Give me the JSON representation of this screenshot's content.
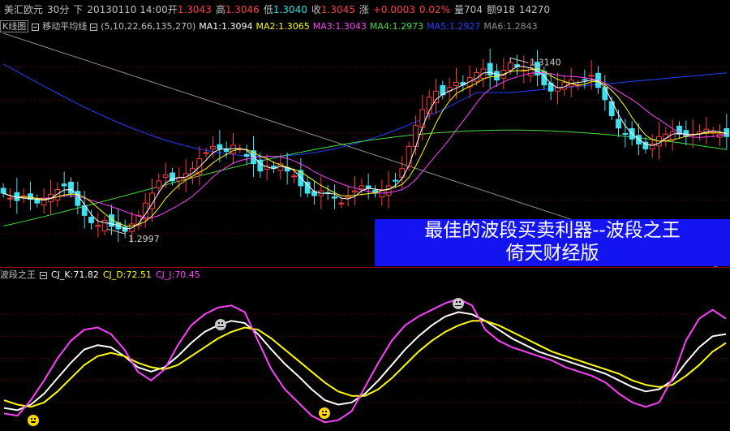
{
  "header": {
    "symbol": "美汇欧元",
    "period": "30分",
    "dir": "下",
    "datetime": "20130110 14:00",
    "open_label": "开",
    "open": "1.3043",
    "high_label": "高",
    "high": "1.3046",
    "low_label": "低",
    "low": "1.3040",
    "close_label": "收",
    "close": "1.3045",
    "change_label": "涨",
    "change": "+0.0003",
    "change_pct": "0.02%",
    "volume": "量704",
    "amount": "额918",
    "extra": "14270"
  },
  "ma_bar": {
    "chart_name": "K线图",
    "indicator": "移动平均线",
    "params": "(5,10,22,66,135,270)",
    "items": [
      {
        "label": "MA1:",
        "value": "1.3094",
        "color": "#ffffff"
      },
      {
        "label": "MA2:",
        "value": "1.3065",
        "color": "#ffff00"
      },
      {
        "label": "MA3:",
        "value": "1.3043",
        "color": "#ff40ff"
      },
      {
        "label": "MA4:",
        "value": "1.2973",
        "color": "#40e040"
      },
      {
        "label": "MA5:",
        "value": "1.2927",
        "color": "#2040ff"
      },
      {
        "label": "MA6:",
        "value": "1.2843",
        "color": "#909090"
      }
    ]
  },
  "sub_bar": {
    "name": "波段之王",
    "items": [
      {
        "label": "CJ_K:",
        "value": "71.82",
        "color": "#ffffff"
      },
      {
        "label": "CJ_D:",
        "value": "72.51",
        "color": "#ffff00"
      },
      {
        "label": "CJ_J:",
        "value": "70.45",
        "color": "#ff40ff"
      }
    ]
  },
  "banner": {
    "line1": "最佳的波段买卖利器--波段之王",
    "line2": "倚天财经版"
  },
  "annotations": {
    "high_mark": "1.3140",
    "low_mark": "1.2997"
  },
  "chart_data": [
    {
      "type": "candlestick",
      "ylim": [
        1.297,
        1.316
      ],
      "grid": true,
      "markers": [
        {
          "label": "1.3140",
          "value": 1.314
        },
        {
          "label": "1.2997",
          "value": 1.2997
        }
      ],
      "closes": [
        1.303,
        1.3026,
        1.3024,
        1.3028,
        1.3025,
        1.3022,
        1.3026,
        1.3029,
        1.3033,
        1.3036,
        1.303,
        1.302,
        1.3012,
        1.3006,
        1.3004,
        1.3008,
        1.3003,
        1.3001,
        1.2999,
        1.3005,
        1.3012,
        1.3022,
        1.303,
        1.304,
        1.3045,
        1.304,
        1.3043,
        1.3046,
        1.305,
        1.3058,
        1.3063,
        1.3068,
        1.3066,
        1.3064,
        1.3069,
        1.3066,
        1.306,
        1.3054,
        1.3048,
        1.3052,
        1.305,
        1.3054,
        1.3048,
        1.3044,
        1.3036,
        1.303,
        1.3028,
        1.3032,
        1.303,
        1.3026,
        1.3022,
        1.3028,
        1.3032,
        1.3036,
        1.3034,
        1.303,
        1.3033,
        1.3036,
        1.304,
        1.305,
        1.3068,
        1.3085,
        1.3098,
        1.3108,
        1.3113,
        1.311,
        1.3116,
        1.312,
        1.3118,
        1.3124,
        1.3128,
        1.3131,
        1.3126,
        1.3122,
        1.313,
        1.3136,
        1.3133,
        1.313,
        1.3132,
        1.3126,
        1.3118,
        1.3113,
        1.3116,
        1.312,
        1.3122,
        1.3118,
        1.3122,
        1.3126,
        1.3116,
        1.3106,
        1.3093,
        1.3083,
        1.3078,
        1.3074,
        1.307,
        1.3066,
        1.307,
        1.3076,
        1.3078,
        1.308,
        1.3078,
        1.3076,
        1.3078,
        1.308,
        1.3082,
        1.308,
        1.3078,
        1.3076
      ]
    },
    {
      "type": "line",
      "ylim": [
        -10,
        110
      ],
      "series": [
        {
          "name": "CJ_K",
          "color": "#ffffff",
          "values": [
            5,
            3,
            8,
            18,
            32,
            46,
            58,
            62,
            60,
            52,
            42,
            38,
            42,
            52,
            64,
            74,
            80,
            84,
            82,
            72,
            58,
            45,
            34,
            22,
            12,
            8,
            10,
            18,
            30,
            44,
            58,
            70,
            80,
            88,
            92,
            90,
            84,
            76,
            68,
            62,
            56,
            52,
            48,
            44,
            40,
            36,
            30,
            24,
            20,
            22,
            30,
            46,
            60,
            70,
            72
          ]
        },
        {
          "name": "CJ_D",
          "color": "#ffff00",
          "values": [
            12,
            8,
            6,
            10,
            20,
            32,
            44,
            52,
            55,
            52,
            46,
            42,
            40,
            44,
            52,
            60,
            68,
            74,
            78,
            76,
            68,
            58,
            48,
            38,
            28,
            20,
            16,
            16,
            22,
            32,
            44,
            56,
            66,
            74,
            80,
            84,
            84,
            80,
            74,
            68,
            62,
            56,
            52,
            48,
            44,
            40,
            36,
            30,
            26,
            24,
            26,
            34,
            44,
            56,
            64
          ]
        },
        {
          "name": "CJ_J",
          "color": "#ff40ff",
          "values": [
            0,
            -2,
            12,
            30,
            50,
            66,
            76,
            78,
            72,
            58,
            38,
            30,
            40,
            62,
            80,
            90,
            96,
            98,
            92,
            66,
            40,
            22,
            10,
            -2,
            -8,
            -6,
            2,
            24,
            46,
            66,
            80,
            88,
            94,
            100,
            104,
            98,
            76,
            66,
            60,
            56,
            52,
            48,
            42,
            38,
            34,
            28,
            18,
            10,
            6,
            10,
            32,
            66,
            86,
            94,
            86
          ]
        }
      ]
    }
  ]
}
